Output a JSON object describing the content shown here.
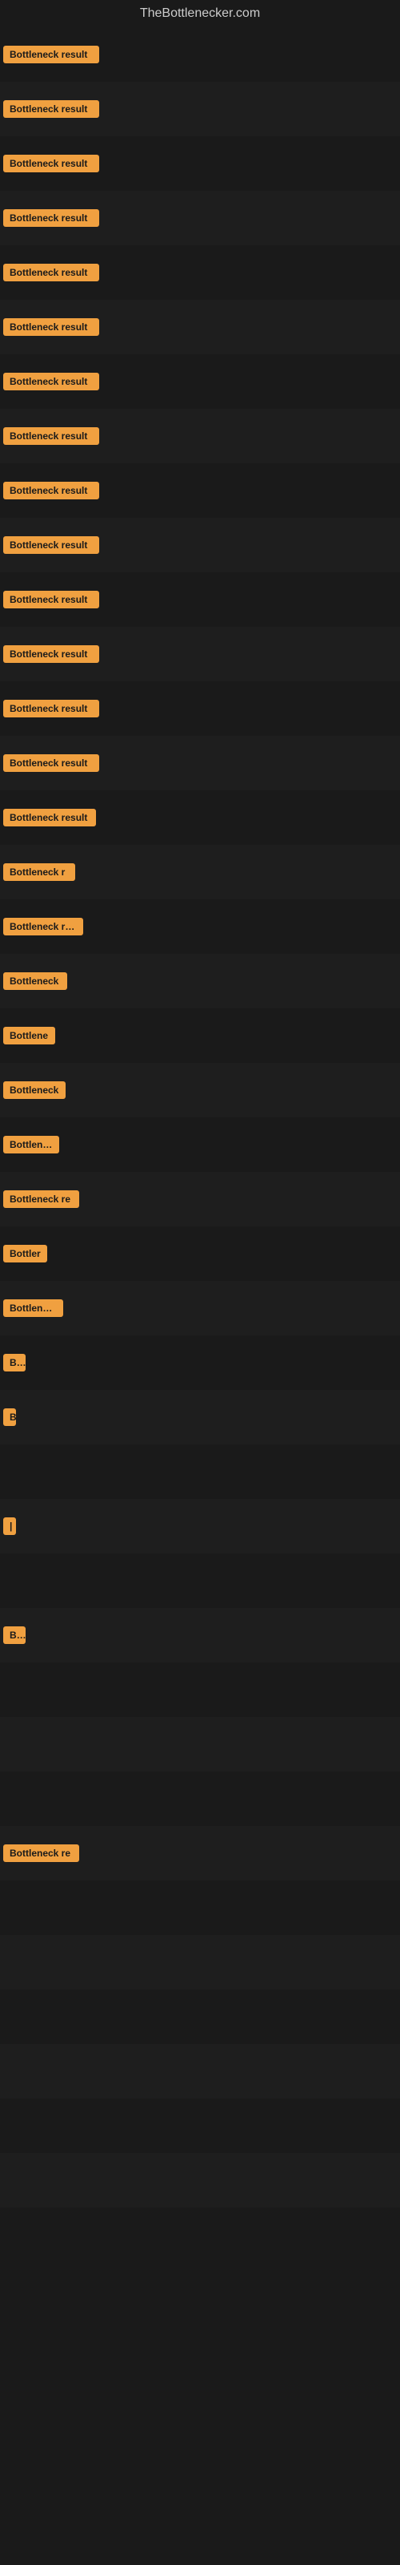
{
  "site": {
    "title": "TheBottlenecker.com"
  },
  "rows": [
    {
      "id": 1,
      "label": "Bottleneck result",
      "width": 120,
      "visible": true
    },
    {
      "id": 2,
      "label": "Bottleneck result",
      "width": 120,
      "visible": true
    },
    {
      "id": 3,
      "label": "Bottleneck result",
      "width": 120,
      "visible": true
    },
    {
      "id": 4,
      "label": "Bottleneck result",
      "width": 120,
      "visible": true
    },
    {
      "id": 5,
      "label": "Bottleneck result",
      "width": 120,
      "visible": true
    },
    {
      "id": 6,
      "label": "Bottleneck result",
      "width": 120,
      "visible": true
    },
    {
      "id": 7,
      "label": "Bottleneck result",
      "width": 120,
      "visible": true
    },
    {
      "id": 8,
      "label": "Bottleneck result",
      "width": 120,
      "visible": true
    },
    {
      "id": 9,
      "label": "Bottleneck result",
      "width": 120,
      "visible": true
    },
    {
      "id": 10,
      "label": "Bottleneck result",
      "width": 120,
      "visible": true
    },
    {
      "id": 11,
      "label": "Bottleneck result",
      "width": 120,
      "visible": true
    },
    {
      "id": 12,
      "label": "Bottleneck result",
      "width": 120,
      "visible": true
    },
    {
      "id": 13,
      "label": "Bottleneck result",
      "width": 120,
      "visible": true
    },
    {
      "id": 14,
      "label": "Bottleneck result",
      "width": 120,
      "visible": true
    },
    {
      "id": 15,
      "label": "Bottleneck result",
      "width": 116,
      "visible": true
    },
    {
      "id": 16,
      "label": "Bottleneck r",
      "width": 90,
      "visible": true
    },
    {
      "id": 17,
      "label": "Bottleneck resu",
      "width": 100,
      "visible": true
    },
    {
      "id": 18,
      "label": "Bottleneck",
      "width": 80,
      "visible": true
    },
    {
      "id": 19,
      "label": "Bottlene",
      "width": 65,
      "visible": true
    },
    {
      "id": 20,
      "label": "Bottleneck",
      "width": 78,
      "visible": true
    },
    {
      "id": 21,
      "label": "Bottlenec",
      "width": 70,
      "visible": true
    },
    {
      "id": 22,
      "label": "Bottleneck re",
      "width": 95,
      "visible": true
    },
    {
      "id": 23,
      "label": "Bottler",
      "width": 55,
      "visible": true
    },
    {
      "id": 24,
      "label": "Bottleneck",
      "width": 75,
      "visible": true
    },
    {
      "id": 25,
      "label": "Bo",
      "width": 28,
      "visible": true
    },
    {
      "id": 26,
      "label": "B",
      "width": 16,
      "visible": true
    },
    {
      "id": 27,
      "label": "",
      "width": 0,
      "visible": false
    },
    {
      "id": 28,
      "label": "|",
      "width": 8,
      "visible": true
    },
    {
      "id": 29,
      "label": "",
      "width": 0,
      "visible": false
    },
    {
      "id": 30,
      "label": "Bot",
      "width": 28,
      "visible": true
    },
    {
      "id": 31,
      "label": "",
      "width": 0,
      "visible": false
    },
    {
      "id": 32,
      "label": "",
      "width": 0,
      "visible": false
    },
    {
      "id": 33,
      "label": "",
      "width": 0,
      "visible": false
    },
    {
      "id": 34,
      "label": "Bottleneck re",
      "width": 95,
      "visible": true
    },
    {
      "id": 35,
      "label": "",
      "width": 0,
      "visible": false
    },
    {
      "id": 36,
      "label": "",
      "width": 0,
      "visible": false
    },
    {
      "id": 37,
      "label": "",
      "width": 0,
      "visible": false
    },
    {
      "id": 38,
      "label": "",
      "width": 0,
      "visible": false
    },
    {
      "id": 39,
      "label": "",
      "width": 0,
      "visible": false
    },
    {
      "id": 40,
      "label": "",
      "width": 0,
      "visible": false
    }
  ]
}
